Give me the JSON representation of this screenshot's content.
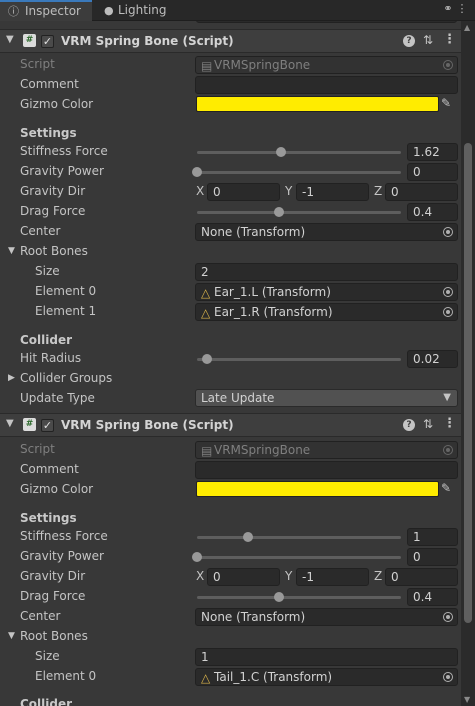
{
  "tabs": {
    "inspector": "Inspector",
    "lighting": "Lighting"
  },
  "components": [
    {
      "title": "VRM Spring Bone (Script)",
      "script_label": "Script",
      "script_value": "VRMSpringBone",
      "comment_label": "Comment",
      "comment_value": "",
      "gizmo_label": "Gizmo Color",
      "gizmo_color": "#ffec00",
      "settings_label": "Settings",
      "stiffness_label": "Stiffness Force",
      "stiffness_value": "1.62",
      "stiffness_fraction": 0.41,
      "gravity_power_label": "Gravity Power",
      "gravity_power_value": "0",
      "gravity_power_fraction": 0.0,
      "gravity_dir_label": "Gravity Dir",
      "gravity_dir": {
        "x": "0",
        "y": "-1",
        "z": "0"
      },
      "drag_label": "Drag Force",
      "drag_value": "0.4",
      "drag_fraction": 0.4,
      "center_label": "Center",
      "center_value": "None (Transform)",
      "root_bones_label": "Root Bones",
      "size_label": "Size",
      "size_value": "2",
      "elements": [
        {
          "label": "Element 0",
          "value": "Ear_1.L (Transform)"
        },
        {
          "label": "Element 1",
          "value": "Ear_1.R (Transform)"
        }
      ],
      "collider_label": "Collider",
      "hit_radius_label": "Hit Radius",
      "hit_radius_value": "0.02",
      "hit_radius_fraction": 0.05,
      "collider_groups_label": "Collider Groups",
      "update_type_label": "Update Type",
      "update_type_value": "Late Update"
    },
    {
      "title": "VRM Spring Bone (Script)",
      "script_label": "Script",
      "script_value": "VRMSpringBone",
      "comment_label": "Comment",
      "comment_value": "",
      "gizmo_label": "Gizmo Color",
      "gizmo_color": "#ffec00",
      "settings_label": "Settings",
      "stiffness_label": "Stiffness Force",
      "stiffness_value": "1",
      "stiffness_fraction": 0.25,
      "gravity_power_label": "Gravity Power",
      "gravity_power_value": "0",
      "gravity_power_fraction": 0.0,
      "gravity_dir_label": "Gravity Dir",
      "gravity_dir": {
        "x": "0",
        "y": "-1",
        "z": "0"
      },
      "drag_label": "Drag Force",
      "drag_value": "0.4",
      "drag_fraction": 0.4,
      "center_label": "Center",
      "center_value": "None (Transform)",
      "root_bones_label": "Root Bones",
      "size_label": "Size",
      "size_value": "1",
      "elements": [
        {
          "label": "Element 0",
          "value": "Tail_1.C (Transform)"
        }
      ],
      "collider_label": "Collider"
    }
  ],
  "colors": {
    "accent": "#3a79bb",
    "gizmo": "#ffec00",
    "background": "#383838"
  }
}
